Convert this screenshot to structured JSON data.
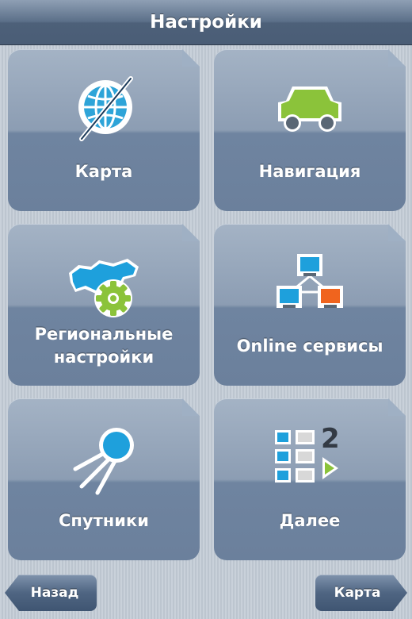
{
  "header": {
    "title": "Настройки"
  },
  "tiles": [
    {
      "label": "Карта",
      "icon": "globe-icon"
    },
    {
      "label": "Навигация",
      "icon": "car-icon"
    },
    {
      "label": "Региональные\nнастройки",
      "icon": "map-gear-icon"
    },
    {
      "label": "Online сервисы",
      "icon": "network-computers-icon"
    },
    {
      "label": "Спутники",
      "icon": "satellite-icon"
    },
    {
      "label": "Далее",
      "icon": "next-page-icon"
    }
  ],
  "footer": {
    "back_label": "Назад",
    "map_label": "Карта"
  },
  "colors": {
    "accent_green": "#8bc33a",
    "accent_blue": "#1ea0dc",
    "accent_orange": "#f0641e"
  }
}
